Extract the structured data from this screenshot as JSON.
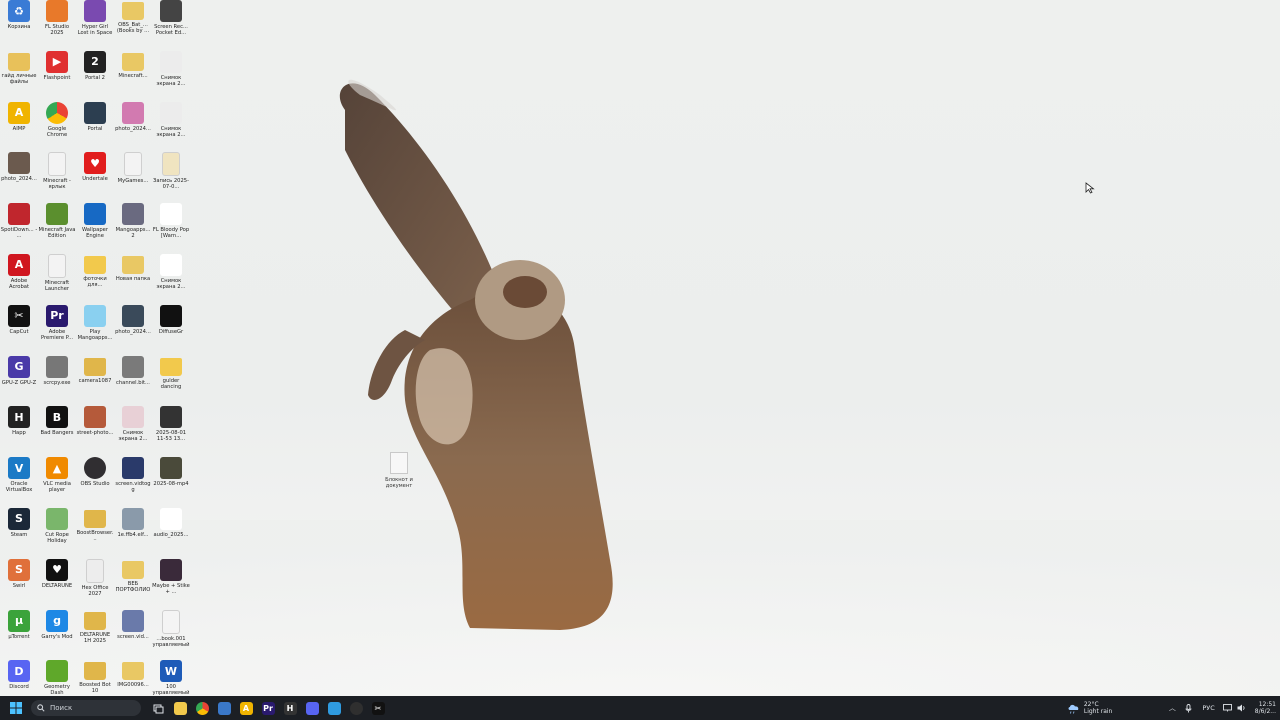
{
  "desktop": {
    "icons": [
      {
        "label": "Корзина",
        "color": "#3a7bd5",
        "glyph": "♻",
        "icon": "recycle-bin-icon"
      },
      {
        "label": "гайд личные файлы",
        "color": "#e8c15a",
        "glyph": "",
        "icon": "folder-icon"
      },
      {
        "label": "AIMP",
        "color": "#f0b400",
        "glyph": "A",
        "icon": "aimp-icon"
      },
      {
        "label": "photo_2024...",
        "color": "#6b5a4e",
        "glyph": "",
        "icon": "image-icon"
      },
      {
        "label": "SpotiDown... - ...",
        "color": "#c0262d",
        "glyph": "",
        "icon": "app-icon"
      },
      {
        "label": "Adobe Acrobat",
        "color": "#d0161f",
        "glyph": "A",
        "icon": "acrobat-icon"
      },
      {
        "label": "CapCut",
        "color": "#111111",
        "glyph": "✂",
        "icon": "capcut-icon"
      },
      {
        "label": "GPU-Z GPU-Z",
        "color": "#4a3aa8",
        "glyph": "G",
        "icon": "gpuz-icon"
      },
      {
        "label": "Happ",
        "color": "#222222",
        "glyph": "H",
        "icon": "happ-icon"
      },
      {
        "label": "Oracle VirtualBox",
        "color": "#1b7ac6",
        "glyph": "V",
        "icon": "virtualbox-icon"
      },
      {
        "label": "Steam",
        "color": "#1b2838",
        "glyph": "S",
        "icon": "steam-icon"
      },
      {
        "label": "Swirl",
        "color": "#e0703a",
        "glyph": "S",
        "icon": "app-icon"
      },
      {
        "label": "µTorrent",
        "color": "#3ba33b",
        "glyph": "µ",
        "icon": "utorrent-icon"
      },
      {
        "label": "Discord",
        "color": "#5865f2",
        "glyph": "D",
        "icon": "discord-icon"
      },
      {
        "label": "FL Studio 2025",
        "color": "#e8792a",
        "glyph": "",
        "icon": "flstudio-icon"
      },
      {
        "label": "Flashpoint",
        "color": "#e03030",
        "glyph": "▶",
        "icon": "flashpoint-icon"
      },
      {
        "label": "Google Chrome",
        "color": "#4285f4",
        "glyph": "",
        "icon": "chrome-icon"
      },
      {
        "label": "Minecraft - ярлык",
        "color": "#f3f3f3",
        "glyph": "",
        "icon": "file-icon"
      },
      {
        "label": "Minecraft Java Edition",
        "color": "#5b8f2e",
        "glyph": "",
        "icon": "minecraft-icon"
      },
      {
        "label": "Minecraft Launcher",
        "color": "#f3f3f3",
        "glyph": "",
        "icon": "file-icon"
      },
      {
        "label": "Adobe Premiere P...",
        "color": "#2a1a6e",
        "glyph": "Pr",
        "icon": "premiere-icon"
      },
      {
        "label": "scrcpy.exe",
        "color": "#777777",
        "glyph": "",
        "icon": "app-icon"
      },
      {
        "label": "Bad Bangers",
        "color": "#111111",
        "glyph": "B",
        "icon": "app-icon"
      },
      {
        "label": "VLC media player",
        "color": "#f08a00",
        "glyph": "▲",
        "icon": "vlc-icon"
      },
      {
        "label": "Cut Rope Holiday",
        "color": "#7ab66b",
        "glyph": "",
        "icon": "game-icon"
      },
      {
        "label": "DELTARUNE",
        "color": "#111111",
        "glyph": "♥",
        "icon": "deltarune-icon"
      },
      {
        "label": "Garry's Mod",
        "color": "#1e88e5",
        "glyph": "g",
        "icon": "gmod-icon"
      },
      {
        "label": "Geometry Dash",
        "color": "#5fa82a",
        "glyph": "",
        "icon": "gd-icon"
      },
      {
        "label": "Hyper Girl Lost in Space",
        "color": "#7a4ab0",
        "glyph": "",
        "icon": "game-icon"
      },
      {
        "label": "Portal 2",
        "color": "#222222",
        "glyph": "2",
        "icon": "portal2-icon"
      },
      {
        "label": "Portal",
        "color": "#2c3e50",
        "glyph": "",
        "icon": "portal-icon"
      },
      {
        "label": "Undertale",
        "color": "#e11d1d",
        "glyph": "♥",
        "icon": "undertale-icon"
      },
      {
        "label": "Wallpaper Engine",
        "color": "#1769c4",
        "glyph": "",
        "icon": "wallpaper-engine-icon"
      },
      {
        "label": "фоточки для...",
        "color": "#f2c94c",
        "glyph": "",
        "icon": "folder-icon"
      },
      {
        "label": "Play Mangoapps...",
        "color": "#8ad0f0",
        "glyph": "",
        "icon": "app-icon"
      },
      {
        "label": "camera1087",
        "color": "#e0b64a",
        "glyph": "",
        "icon": "folder-icon"
      },
      {
        "label": "street-photo...",
        "color": "#b55a3a",
        "glyph": "",
        "icon": "image-icon"
      },
      {
        "label": "OBS Studio",
        "color": "#302e31",
        "glyph": "",
        "icon": "obs-icon"
      },
      {
        "label": "BoostBrowser...",
        "color": "#e0b64a",
        "glyph": "",
        "icon": "folder-icon"
      },
      {
        "label": "Hex Office 2027",
        "color": "#ededed",
        "glyph": "",
        "icon": "file-icon"
      },
      {
        "label": "DELTARUNE 1H 2025",
        "color": "#e0b64a",
        "glyph": "",
        "icon": "folder-icon"
      },
      {
        "label": "Boosted Bot 10",
        "color": "#e0b64a",
        "glyph": "",
        "icon": "folder-icon"
      },
      {
        "label": "OBS_Bat_... (Books by ...",
        "color": "#e9c864",
        "glyph": "",
        "icon": "folder-icon"
      },
      {
        "label": "Minecraft...",
        "color": "#e9c864",
        "glyph": "",
        "icon": "folder-icon"
      },
      {
        "label": "photo_2024...",
        "color": "#d27ab0",
        "glyph": "",
        "icon": "image-icon"
      },
      {
        "label": "MyGames...",
        "color": "#f3f3f3",
        "glyph": "",
        "icon": "file-icon"
      },
      {
        "label": "Mangoapps... 2",
        "color": "#6a6a80",
        "glyph": "",
        "icon": "app-icon"
      },
      {
        "label": "Новая папка",
        "color": "#e9c864",
        "glyph": "",
        "icon": "folder-icon"
      },
      {
        "label": "photo_2024...",
        "color": "#3a4a5a",
        "glyph": "",
        "icon": "image-icon"
      },
      {
        "label": "channel.bit...",
        "color": "#7a7a7a",
        "glyph": "",
        "icon": "image-icon"
      },
      {
        "label": "Снимок экрана 2...",
        "color": "#e8d0d6",
        "glyph": "",
        "icon": "image-icon"
      },
      {
        "label": "screen.vidtogg",
        "color": "#2a3a6a",
        "glyph": "",
        "icon": "image-icon"
      },
      {
        "label": "1e.ffb4.elf...",
        "color": "#8a9aaa",
        "glyph": "",
        "icon": "image-icon"
      },
      {
        "label": "ВЕБ ПОРТФОЛИО",
        "color": "#e9c864",
        "glyph": "",
        "icon": "folder-icon"
      },
      {
        "label": "screen.vid...",
        "color": "#6a7aaa",
        "glyph": "",
        "icon": "image-icon"
      },
      {
        "label": "IMG00096...",
        "color": "#e9c864",
        "glyph": "",
        "icon": "folder-icon"
      },
      {
        "label": "Screen Rec... Pocket Ed...",
        "color": "#444444",
        "glyph": "",
        "icon": "video-icon"
      },
      {
        "label": "Снимок экрана 2...",
        "color": "#ececec",
        "glyph": "",
        "icon": "image-icon"
      },
      {
        "label": "Снимок экрана 2...",
        "color": "#ececec",
        "glyph": "",
        "icon": "image-icon"
      },
      {
        "label": "Запись 2025-07-0...",
        "color": "#f0e4c0",
        "glyph": "",
        "icon": "file-icon"
      },
      {
        "label": "FL Bloody Pop [Warn...",
        "color": "#ffffff",
        "glyph": "▶",
        "icon": "media-icon"
      },
      {
        "label": "Снимок экрана 2...",
        "color": "#ffffff",
        "glyph": "",
        "icon": "image-icon"
      },
      {
        "label": "DiffuseGr",
        "color": "#111111",
        "glyph": "",
        "icon": "phone-icon"
      },
      {
        "label": "gulder dancing",
        "color": "#f2c94c",
        "glyph": "",
        "icon": "folder-icon"
      },
      {
        "label": "2025-08-01 11-53 13...",
        "color": "#333333",
        "glyph": "",
        "icon": "video-icon"
      },
      {
        "label": "2025-08-mp4",
        "color": "#4a4a3a",
        "glyph": "",
        "icon": "video-icon"
      },
      {
        "label": "audio_2025...",
        "color": "#ffffff",
        "glyph": "▶",
        "icon": "media-icon"
      },
      {
        "label": "Maybe + Stike + ...",
        "color": "#3a2a3a",
        "glyph": "",
        "icon": "video-icon"
      },
      {
        "label": "...book.001 управляемый",
        "color": "#f4f4f4",
        "glyph": "",
        "icon": "file-icon"
      },
      {
        "label": "100 управляемый",
        "color": "#1e5bb8",
        "glyph": "W",
        "icon": "word-icon"
      }
    ],
    "loose_file": {
      "label": "Блокнот и документ"
    }
  },
  "taskbar": {
    "search_placeholder": "Поиск",
    "apps": [
      {
        "name": "file-explorer",
        "color": "#f2c94c",
        "glyph": ""
      },
      {
        "name": "chrome",
        "color": "#4285f4",
        "glyph": ""
      },
      {
        "name": "store",
        "color": "#3a78c9",
        "glyph": ""
      },
      {
        "name": "aimp",
        "color": "#f0b400",
        "glyph": "A"
      },
      {
        "name": "premiere",
        "color": "#2a1a6e",
        "glyph": "Pr"
      },
      {
        "name": "happ",
        "color": "#333333",
        "glyph": "H"
      },
      {
        "name": "discord",
        "color": "#5865f2",
        "glyph": ""
      },
      {
        "name": "app-blue",
        "color": "#2f9be0",
        "glyph": ""
      },
      {
        "name": "obs",
        "color": "#2f2f2f",
        "glyph": ""
      },
      {
        "name": "capcut",
        "color": "#111111",
        "glyph": "✂"
      }
    ],
    "weather": {
      "temp": "22°C",
      "desc": "Light rain"
    },
    "lang": "РУС",
    "time": "12:51",
    "date": "8/6/2..."
  }
}
